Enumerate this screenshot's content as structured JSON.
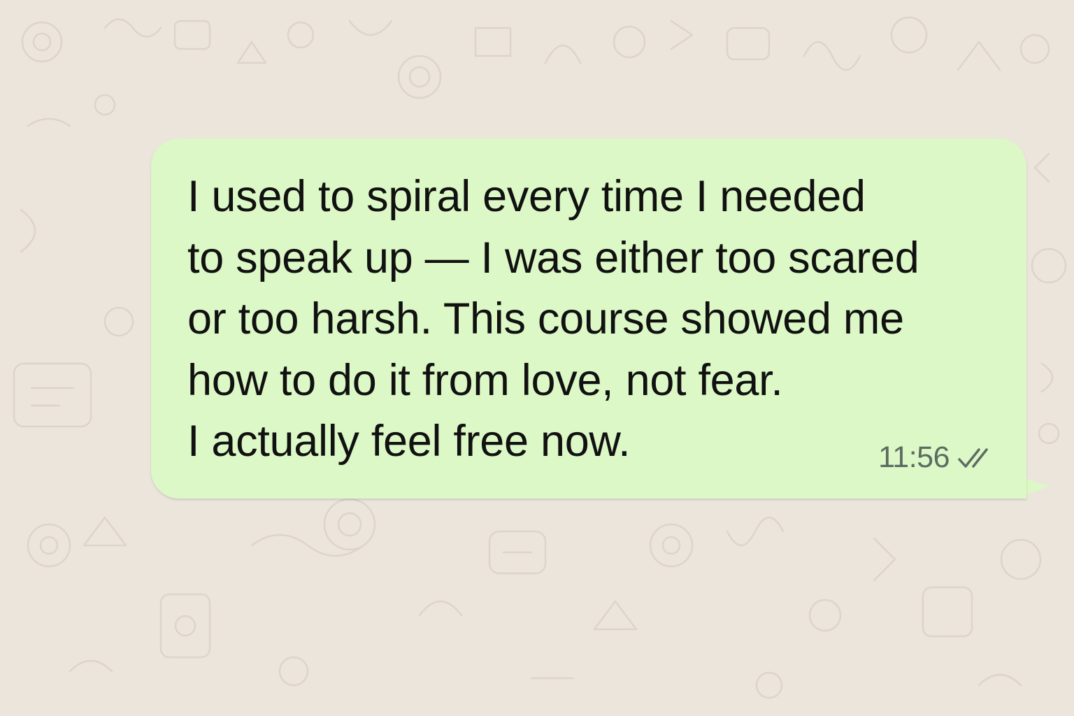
{
  "chat": {
    "wallpaper_color": "#ece5dc",
    "bubble_color": "#dcf8c6",
    "message": {
      "text": "I used to spiral every time I needed\nto speak up — I was either too scared\nor too harsh. This course showed me\nhow to do it from love, not fear.\nI actually feel free now.",
      "time": "11:56",
      "status_icon": "double-check-icon"
    }
  }
}
